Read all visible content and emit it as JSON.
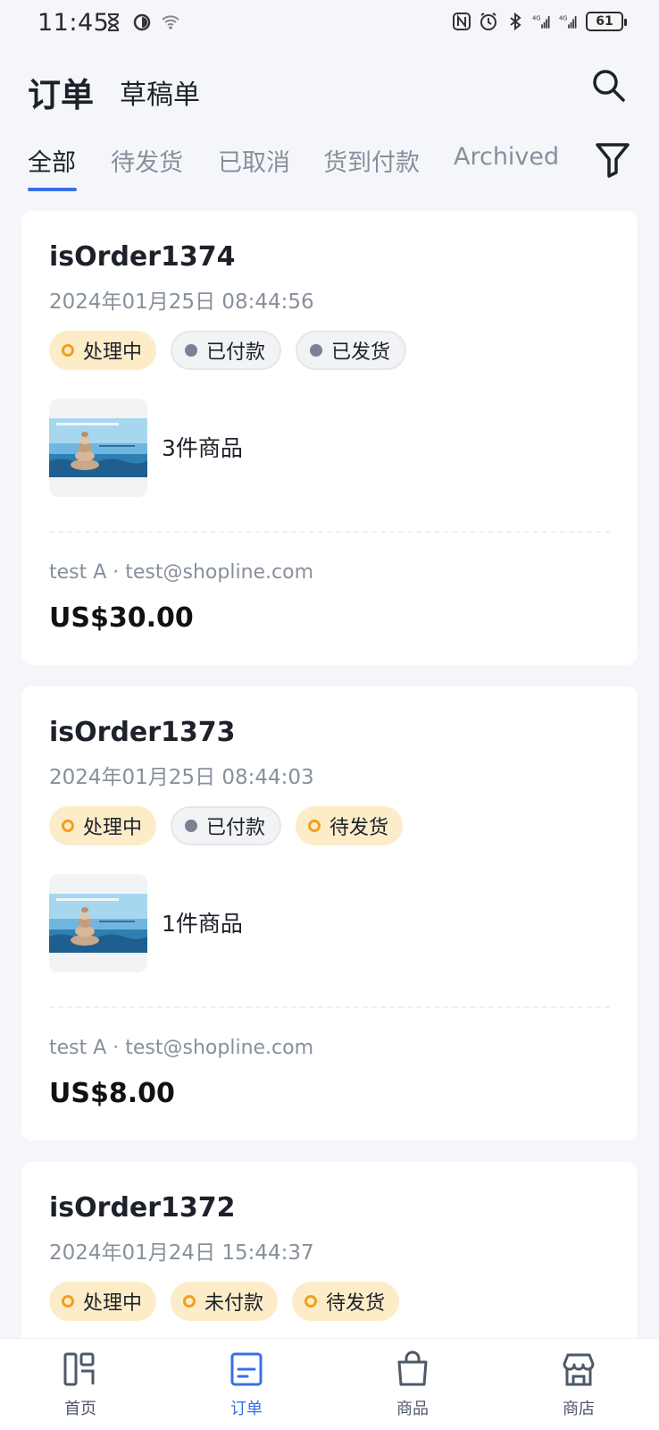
{
  "status_bar": {
    "time": "11:45",
    "battery": "61"
  },
  "header": {
    "title": "订单",
    "subtitle": "草稿单"
  },
  "tabs": [
    {
      "label": "全部",
      "active": true
    },
    {
      "label": "待发货",
      "active": false
    },
    {
      "label": "已取消",
      "active": false
    },
    {
      "label": "货到付款",
      "active": false
    },
    {
      "label": "Archived",
      "active": false
    }
  ],
  "orders": [
    {
      "number": "isOrder1374",
      "date": "2024年01月25日 08:44:56",
      "badges": [
        {
          "label": "处理中",
          "kind": "warn"
        },
        {
          "label": "已付款",
          "kind": "neutral"
        },
        {
          "label": "已发货",
          "kind": "neutral"
        }
      ],
      "items": "3件商品",
      "customer": "test A · test@shopline.com",
      "amount": "US$30.00"
    },
    {
      "number": "isOrder1373",
      "date": "2024年01月25日 08:44:03",
      "badges": [
        {
          "label": "处理中",
          "kind": "warn"
        },
        {
          "label": "已付款",
          "kind": "neutral"
        },
        {
          "label": "待发货",
          "kind": "warn"
        }
      ],
      "items": "1件商品",
      "customer": "test A · test@shopline.com",
      "amount": "US$8.00"
    },
    {
      "number": "isOrder1372",
      "date": "2024年01月24日 15:44:37",
      "badges": [
        {
          "label": "处理中",
          "kind": "warn"
        },
        {
          "label": "未付款",
          "kind": "warn"
        },
        {
          "label": "待发货",
          "kind": "warn"
        }
      ]
    }
  ],
  "bottom_nav": [
    {
      "label": "首页",
      "icon": "home-icon",
      "active": false
    },
    {
      "label": "订单",
      "icon": "orders-icon",
      "active": true
    },
    {
      "label": "商品",
      "icon": "bag-icon",
      "active": false
    },
    {
      "label": "商店",
      "icon": "store-icon",
      "active": false
    }
  ],
  "colors": {
    "accent": "#3a6fe8",
    "warn_badge_bg": "#fdecc8",
    "warn_dot": "#f0a21c",
    "neutral_dot": "#7a8194"
  }
}
